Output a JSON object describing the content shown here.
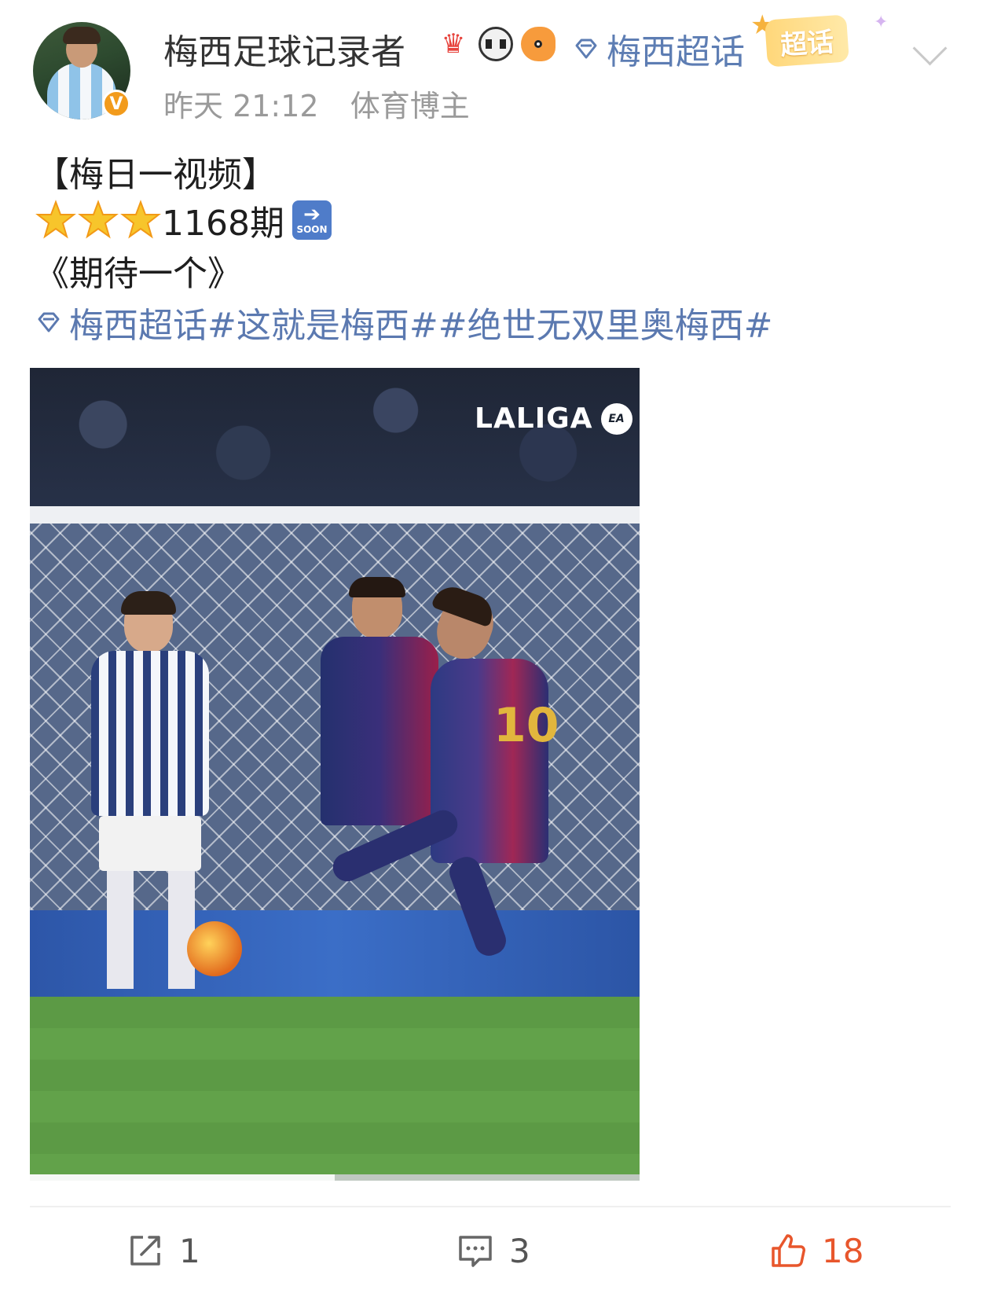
{
  "header": {
    "username": "梅西足球记录者",
    "verified_badge": "V",
    "badges": [
      "crown-icon",
      "panda-icon",
      "fish-icon"
    ],
    "supertopic_link": "梅西超话",
    "supertopic_tag": "超话",
    "timestamp": "昨天 21:12",
    "user_type": "体育博主"
  },
  "post": {
    "line1": "【梅日一视频】",
    "episode": "1168期",
    "soon_label": "SOON",
    "line3": "《期待一个》",
    "topics": {
      "supertopic": "梅西超话",
      "hashtags": " #这就是梅西##绝世无双里奥梅西#"
    }
  },
  "video": {
    "watermark": "LALIGA",
    "ea_logo": "EA",
    "shirt_number": "10",
    "progress_fraction": 0.5
  },
  "actions": {
    "share_count": "1",
    "comment_count": "3",
    "like_count": "18"
  },
  "colors": {
    "link_blue": "#5b79b0",
    "like_orange": "#e8562c",
    "verified_orange": "#f29b1c"
  }
}
